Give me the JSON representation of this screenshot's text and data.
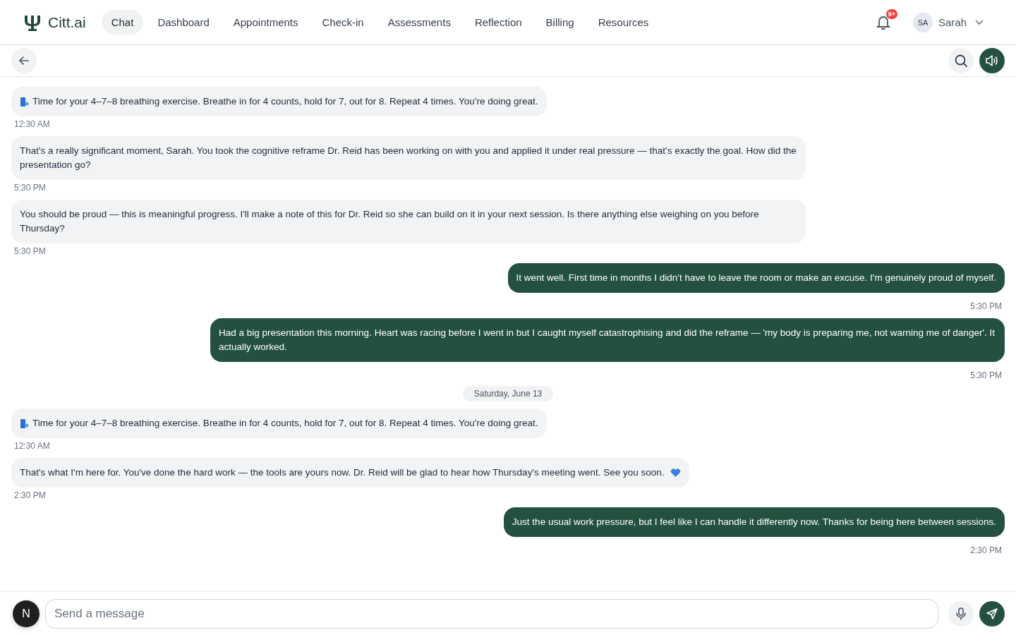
{
  "brand": "Citt.ai",
  "nav": [
    {
      "label": "Chat",
      "selected": true
    },
    {
      "label": "Dashboard",
      "selected": false
    },
    {
      "label": "Appointments",
      "selected": false
    },
    {
      "label": "Check-in",
      "selected": false
    },
    {
      "label": "Assessments",
      "selected": false
    },
    {
      "label": "Reflection",
      "selected": false
    },
    {
      "label": "Billing",
      "selected": false
    },
    {
      "label": "Resources",
      "selected": false
    }
  ],
  "notifications": {
    "badge": "9+"
  },
  "user": {
    "initials": "SA",
    "name": "Sarah"
  },
  "messages": [
    {
      "kind": "bot",
      "lead_icon": true,
      "trail_icon": false,
      "text": "Time for your 4–7–8 breathing exercise. Breathe in for 4 counts, hold for 7, out for 8. Repeat 4 times. You're doing great.",
      "time": "12:30 AM"
    },
    {
      "kind": "bot",
      "lead_icon": false,
      "trail_icon": false,
      "text": "That's a really significant moment, Sarah. You took the cognitive reframe Dr. Reid has been working on with you and applied it under real pressure — that's exactly the goal. How did the presentation go?",
      "time": "5:30 PM"
    },
    {
      "kind": "bot",
      "lead_icon": false,
      "trail_icon": false,
      "text": "You should be proud — this is meaningful progress. I'll make a note of this for Dr. Reid so she can build on it in your next session. Is there anything else weighing on you before Thursday?",
      "time": "5:30 PM"
    },
    {
      "kind": "user",
      "lead_icon": false,
      "trail_icon": false,
      "text": "It went well. First time in months I didn't have to leave the room or make an excuse. I'm genuinely proud of myself.",
      "time": "5:30 PM"
    },
    {
      "kind": "user",
      "lead_icon": false,
      "trail_icon": false,
      "text": "Had a big presentation this morning. Heart was racing before I went in but I caught myself catastrophising and did the reframe — 'my body is preparing me, not warning me of danger'. It actually worked.",
      "time": "5:30 PM"
    },
    {
      "kind": "date",
      "text": "Saturday, June 13"
    },
    {
      "kind": "bot",
      "lead_icon": true,
      "trail_icon": false,
      "text": "Time for your 4–7–8 breathing exercise. Breathe in for 4 counts, hold for 7, out for 8. Repeat 4 times. You're doing great.",
      "time": "12:30 AM"
    },
    {
      "kind": "bot",
      "lead_icon": false,
      "trail_icon": true,
      "text": "That's what I'm here for. You've done the hard work — the tools are yours now. Dr. Reid will be glad to hear how Thursday's meeting went. See you soon.",
      "time": "2:30 PM"
    },
    {
      "kind": "user",
      "lead_icon": false,
      "trail_icon": false,
      "text": "Just the usual work pressure, but I feel like I can handle it differently now. Thanks for being here between sessions.",
      "time": "2:30 PM"
    }
  ],
  "composer": {
    "avatar": "N",
    "placeholder": "Send a message"
  }
}
